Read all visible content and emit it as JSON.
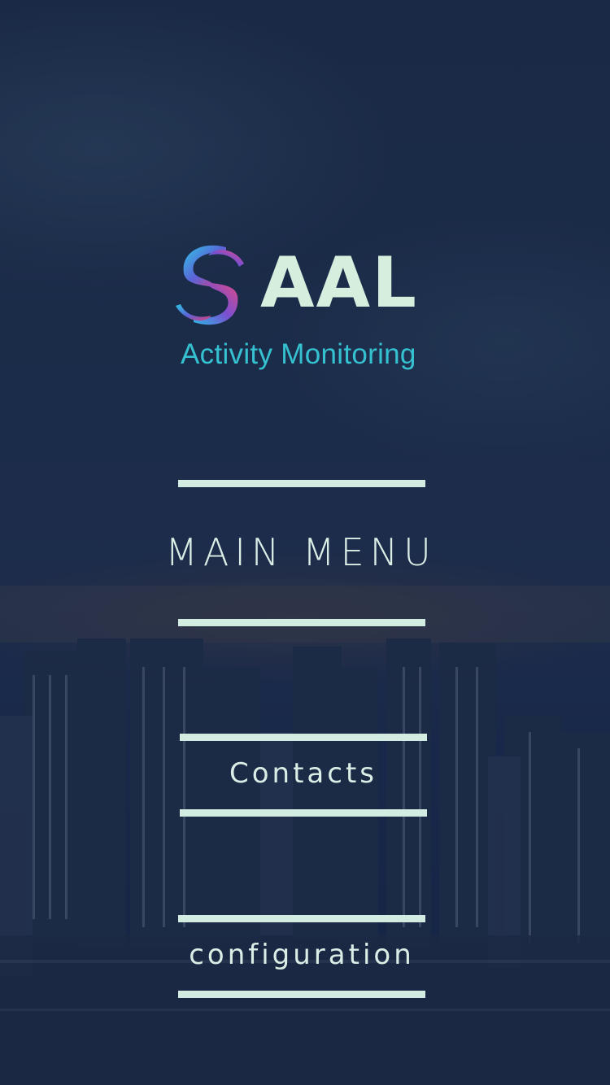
{
  "logo": {
    "brand": "AAL",
    "tagline": "Activity Monitoring",
    "icon": "aal-swirl-logo-icon"
  },
  "header": {
    "title": "MAIN MENU"
  },
  "menu": {
    "items": [
      {
        "label": "Contacts"
      },
      {
        "label": "configuration"
      }
    ]
  },
  "colors": {
    "background": "#1a2a46",
    "accent_line": "#d2ece2",
    "text": "#dbeee6",
    "logo_word": "#d5eedd",
    "logo_tagline": "#35c1d0"
  }
}
